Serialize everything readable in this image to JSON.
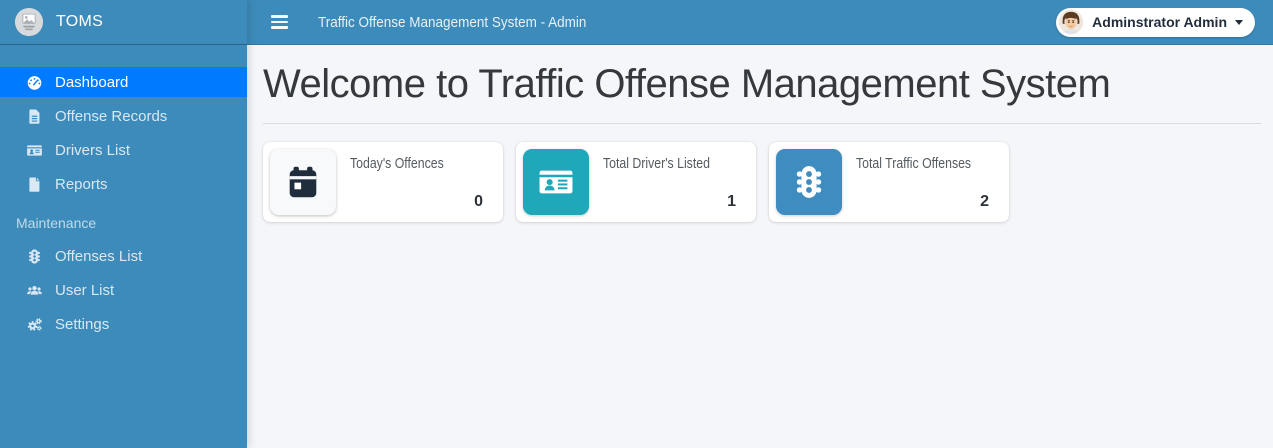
{
  "brand": {
    "name": "TOMS",
    "logo": "image-placeholder-icon"
  },
  "topbar": {
    "title": "Traffic Offense Management System - Admin",
    "menu_icon": "bars-icon",
    "user_name": "Adminstrator Admin",
    "user_caret": "caret-down-icon"
  },
  "sidebar": {
    "items": [
      {
        "label": "Dashboard",
        "icon": "tachometer-icon",
        "active": true
      },
      {
        "label": "Offense Records",
        "icon": "file-lines-icon",
        "active": false
      },
      {
        "label": "Drivers List",
        "icon": "id-card-icon",
        "active": false
      },
      {
        "label": "Reports",
        "icon": "file-icon",
        "active": false
      },
      {
        "label": "Offenses List",
        "icon": "traffic-light-icon",
        "active": false
      },
      {
        "label": "User List",
        "icon": "users-icon",
        "active": false
      },
      {
        "label": "Settings",
        "icon": "cogs-icon",
        "active": false
      }
    ],
    "section_header": "Maintenance"
  },
  "main": {
    "heading": "Welcome to Traffic Offense Management System",
    "cards": [
      {
        "label": "Today's Offences",
        "value": "0",
        "icon": "calendar-icon",
        "tile_color": "#f8f9fa",
        "icon_color": "#1f2d3d"
      },
      {
        "label": "Total Driver's Listed",
        "value": "1",
        "icon": "id-card-icon",
        "tile_color": "#1fa7ba",
        "icon_color": "#ffffff"
      },
      {
        "label": "Total Traffic Offenses",
        "value": "2",
        "icon": "traffic-light-icon",
        "tile_color": "#3e8cc0",
        "icon_color": "#ffffff"
      }
    ]
  },
  "colors": {
    "sidebar_bg": "#3d8bba",
    "topbar_bg": "#3d8bba",
    "active_item_bg": "#007bff",
    "content_bg": "#f4f6f9",
    "card_bg": "#ffffff",
    "heading_text": "#35393e"
  }
}
